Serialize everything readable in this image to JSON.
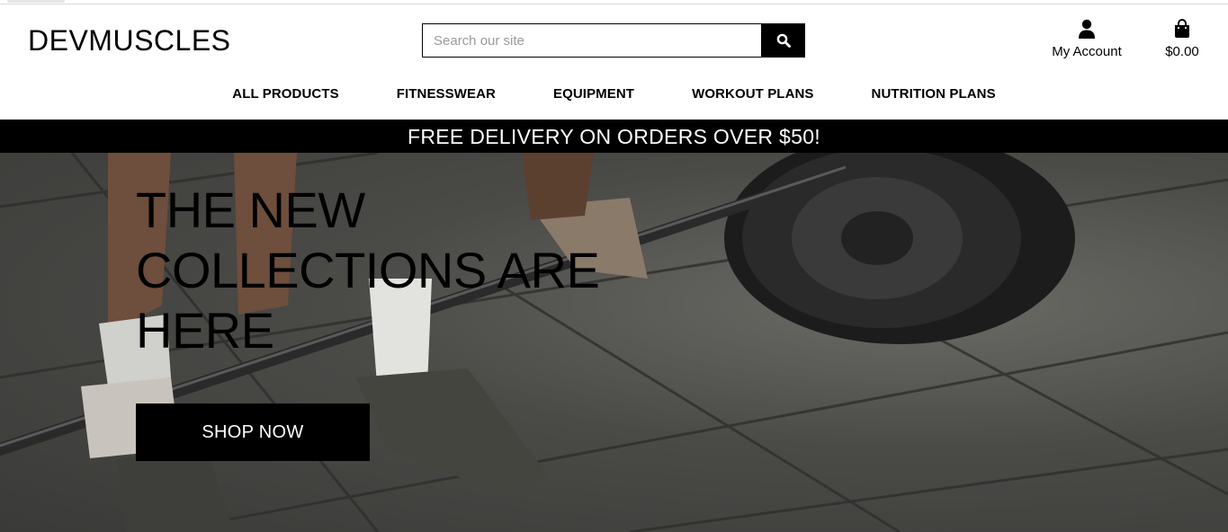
{
  "header": {
    "logo": "DEVMUSCLES",
    "search": {
      "placeholder": "Search our site",
      "value": ""
    },
    "account_label": "My Account",
    "cart_total": "$0.00"
  },
  "nav": {
    "items": [
      {
        "label": "ALL PRODUCTS"
      },
      {
        "label": "FITNESSWEAR"
      },
      {
        "label": "EQUIPMENT"
      },
      {
        "label": "WORKOUT PLANS"
      },
      {
        "label": "NUTRITION PLANS"
      }
    ]
  },
  "promo": {
    "text": "FREE DELIVERY ON ORDERS OVER $50!"
  },
  "hero": {
    "title": "THE NEW COLLECTIONS ARE HERE",
    "cta_label": "SHOP NOW"
  },
  "icons": {
    "search": "search-icon",
    "account": "user-icon",
    "cart": "shopping-bag-icon"
  },
  "colors": {
    "primary": "#000000",
    "background": "#ffffff",
    "banner_text": "#ffffff"
  }
}
